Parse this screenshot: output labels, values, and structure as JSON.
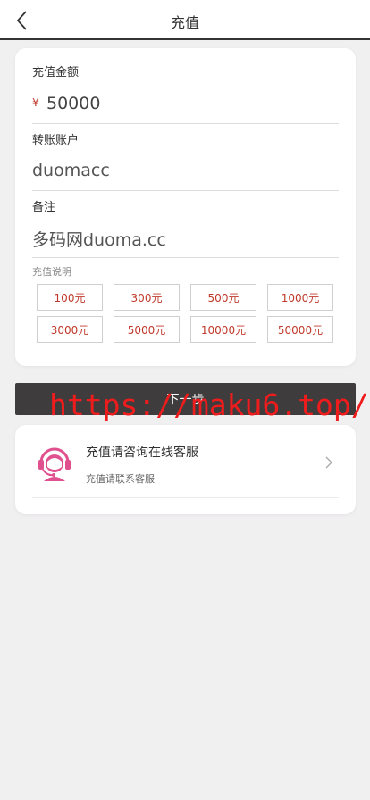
{
  "header": {
    "title": "充值"
  },
  "form": {
    "amount_label": "充值金额",
    "currency_symbol": "¥",
    "amount_value": "50000",
    "account_label": "转账账户",
    "account_value": "duomacc",
    "note_label": "备注",
    "note_value": "多码网duoma.cc",
    "desc_label": "充值说明",
    "presets": [
      "100元",
      "300元",
      "500元",
      "1000元",
      "3000元",
      "5000元",
      "10000元",
      "50000元"
    ]
  },
  "next_button": {
    "label": "下一步"
  },
  "service": {
    "title": "充值请咨询在线客服",
    "subtitle": "充值请联系客服"
  },
  "watermark": "https://maku6.top/",
  "colors": {
    "accent": "#c0392b",
    "button": "#3f3c3d",
    "icon": "#e0508f",
    "watermark": "#ee1c1c"
  }
}
